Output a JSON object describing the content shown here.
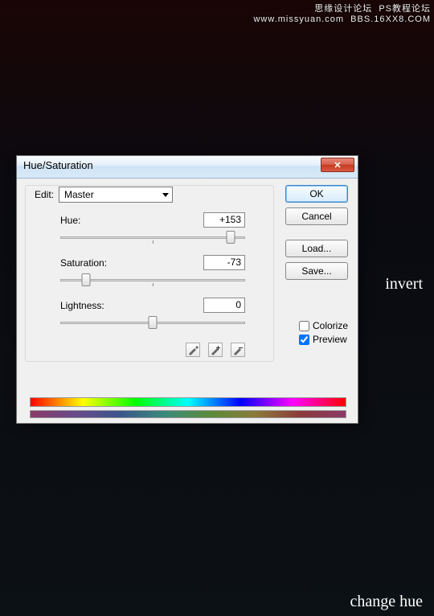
{
  "watermark_top": "思缘设计论坛  PS教程论坛\nwww.missyuan.com  BBS.16XX8.COM",
  "annotation_invert": "invert",
  "annotation_change_hue": "change hue",
  "dialog": {
    "title": "Hue/Saturation",
    "close_glyph": "✕",
    "edit_label": "Edit:",
    "edit_value": "Master",
    "sliders": {
      "hue": {
        "label": "Hue:",
        "value": "+153",
        "pos_pct": 92
      },
      "saturation": {
        "label": "Saturation:",
        "value": "-73",
        "pos_pct": 14
      },
      "lightness": {
        "label": "Lightness:",
        "value": "0",
        "pos_pct": 50
      }
    },
    "buttons": {
      "ok": "OK",
      "cancel": "Cancel",
      "load": "Load...",
      "save": "Save..."
    },
    "colorize_label": "Colorize",
    "preview_label": "Preview",
    "colorize_checked": false,
    "preview_checked": true
  }
}
